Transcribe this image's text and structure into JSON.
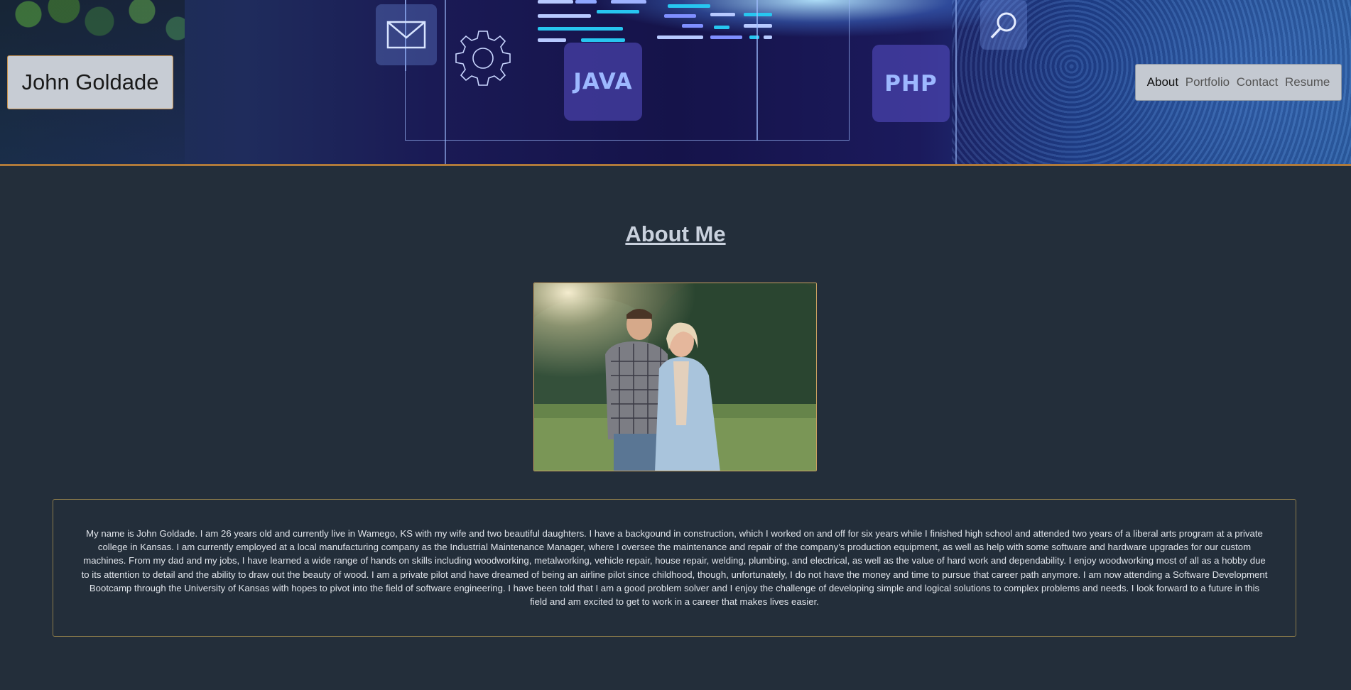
{
  "header": {
    "brand": "John Goldade",
    "banner_tiles": [
      "JAVA",
      "PHP"
    ],
    "banner_icons": [
      "envelope-icon",
      "gear-icon",
      "magnifier-icon"
    ],
    "nav": [
      {
        "label": "About",
        "active": true
      },
      {
        "label": "Portfolio",
        "active": false
      },
      {
        "label": "Contact",
        "active": false
      },
      {
        "label": "Resume",
        "active": false
      }
    ]
  },
  "main": {
    "title": "About Me",
    "bio": "My name is John Goldade. I am 26 years old and currently live in Wamego, KS with my wife and two beautiful daughters. I have a backgound in construction, which I worked on and off for six years while I finished high school and attended two years of a liberal arts program at a private college in Kansas. I am currently employed at a local manufacturing company as the Industrial Maintenance Manager, where I oversee the maintenance and repair of the company's production equipment, as well as help with some software and hardware upgrades for our custom machines. From my dad and my jobs, I have learned a wide range of hands on skills including woodworking, metalworking, vehicle repair, house repair, welding, plumbing, and electrical, as well as the value of hard work and dependability. I enjoy woodworking most of all as a hobby due to its attention to detail and the ability to draw out the beauty of wood. I am a private pilot and have dreamed of being an airline pilot since childhood, though, unfortunately, I do not have the money and time to pursue that career path anymore. I am now attending a Software Development Bootcamp through the University of Kansas with hopes to pivot into the field of software engineering. I have been told that I am a good problem solver and I enjoy the challenge of developing simple and logical solutions to complex problems and needs. I look forward to a future in this field and am excited to get to work in a career that makes lives easier."
  },
  "colors": {
    "page_bg": "#232e3a",
    "accent_border": "#c8904a",
    "heading": "#c9d1dd"
  }
}
